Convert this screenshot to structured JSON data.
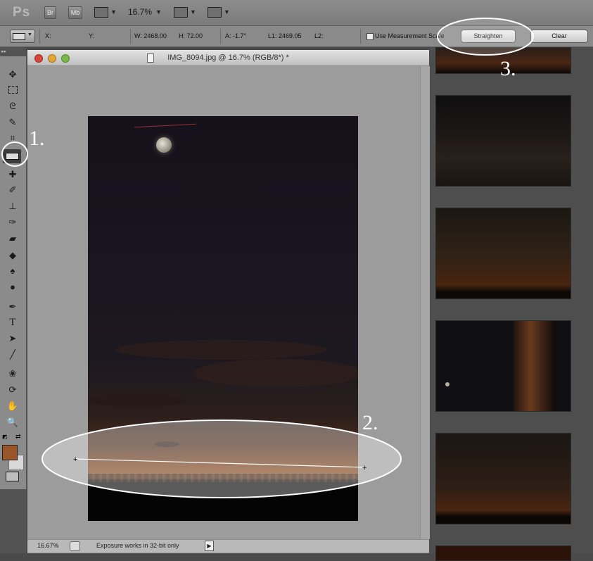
{
  "app": {
    "logo": "Ps",
    "bridge_label": "Br",
    "minibridge_label": "Mb",
    "zoom": "16.7%"
  },
  "options": {
    "x_label": "X:",
    "y_label": "Y:",
    "w_label": "W: 2468.00",
    "h_label": "H: 72.00",
    "a_label": "A: -1.7°",
    "l1_label": "L1: 2469.05",
    "l2_label": "L2:",
    "measurement_scale_label": "Use Measurement Scale",
    "straighten_label": "Straighten",
    "clear_label": "Clear"
  },
  "document": {
    "title": "IMG_8094.jpg @ 16.7% (RGB/8*) *"
  },
  "status": {
    "zoom": "16.67%",
    "info": "Exposure works in 32-bit only"
  },
  "annotations": {
    "step1": "1.",
    "step2": "2.",
    "step3": "3."
  },
  "colors": {
    "foreground": "#9a5528",
    "background": "#d8d8d8"
  },
  "tools": [
    "move-icon",
    "marquee-icon",
    "lasso-icon",
    "quick-select-icon",
    "crop-icon",
    "ruler-icon",
    "healing-brush-icon",
    "brush-icon",
    "clone-stamp-icon",
    "history-brush-icon",
    "eraser-icon",
    "paint-bucket-icon",
    "blur-icon",
    "dodge-icon",
    "pen-icon",
    "type-icon",
    "path-select-icon",
    "line-icon",
    "3d-rotate-icon",
    "3d-orbit-icon",
    "hand-icon",
    "zoom-icon"
  ]
}
